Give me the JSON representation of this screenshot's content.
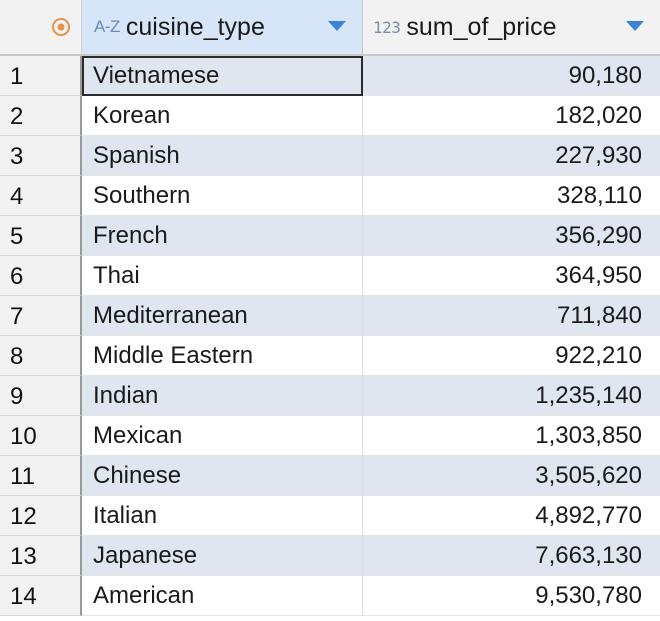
{
  "header": {
    "corner_icon": "target-icon",
    "columns": [
      {
        "type_tag": "A-Z",
        "name": "cuisine_type"
      },
      {
        "type_tag": "123",
        "name": "sum_of_price"
      }
    ]
  },
  "rows": [
    {
      "n": "1",
      "cuisine_type": "Vietnamese",
      "sum_of_price": "90,180"
    },
    {
      "n": "2",
      "cuisine_type": "Korean",
      "sum_of_price": "182,020"
    },
    {
      "n": "3",
      "cuisine_type": "Spanish",
      "sum_of_price": "227,930"
    },
    {
      "n": "4",
      "cuisine_type": "Southern",
      "sum_of_price": "328,110"
    },
    {
      "n": "5",
      "cuisine_type": "French",
      "sum_of_price": "356,290"
    },
    {
      "n": "6",
      "cuisine_type": "Thai",
      "sum_of_price": "364,950"
    },
    {
      "n": "7",
      "cuisine_type": "Mediterranean",
      "sum_of_price": "711,840"
    },
    {
      "n": "8",
      "cuisine_type": "Middle Eastern",
      "sum_of_price": "922,210"
    },
    {
      "n": "9",
      "cuisine_type": "Indian",
      "sum_of_price": "1,235,140"
    },
    {
      "n": "10",
      "cuisine_type": "Mexican",
      "sum_of_price": "1,303,850"
    },
    {
      "n": "11",
      "cuisine_type": "Chinese",
      "sum_of_price": "3,505,620"
    },
    {
      "n": "12",
      "cuisine_type": "Italian",
      "sum_of_price": "4,892,770"
    },
    {
      "n": "13",
      "cuisine_type": "Japanese",
      "sum_of_price": "7,663,130"
    },
    {
      "n": "14",
      "cuisine_type": "American",
      "sum_of_price": "9,530,780"
    }
  ],
  "colors": {
    "header_selected_bg": "#d6e6f8",
    "alt_row_bg": "#dfe6f0",
    "sort_arrow": "#3b84d4",
    "corner_icon": "#e8924a"
  }
}
